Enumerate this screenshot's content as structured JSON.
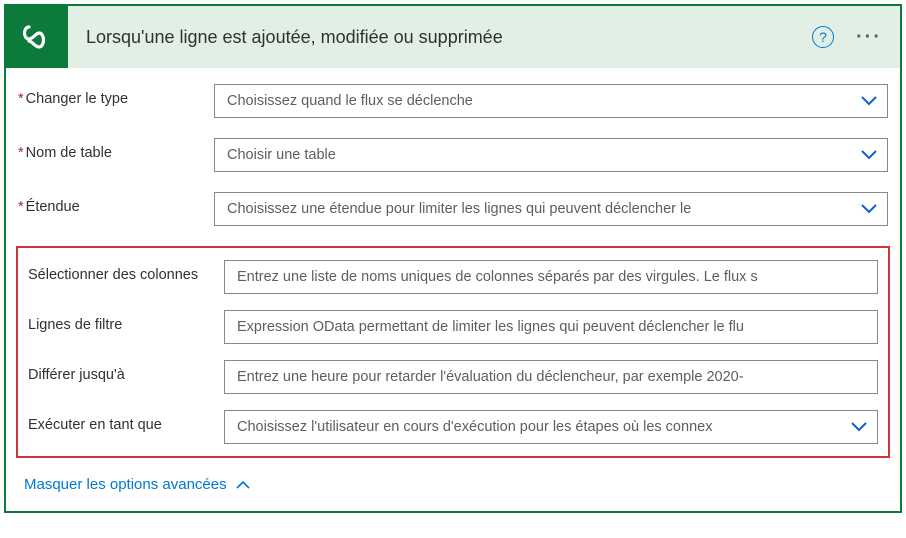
{
  "header": {
    "title": "Lorsqu'une ligne est ajoutée, modifiée ou supprimée"
  },
  "fields": {
    "change_type": {
      "label": "Changer le type",
      "placeholder": "Choisissez quand le flux se déclenche"
    },
    "table_name": {
      "label": "Nom de table",
      "placeholder": "Choisir une table"
    },
    "scope": {
      "label": "Étendue",
      "placeholder": "Choisissez une étendue pour limiter les lignes qui peuvent déclencher le"
    },
    "select_columns": {
      "label": "Sélectionner des colonnes",
      "placeholder": "Entrez une liste de noms uniques de colonnes séparés par des virgules. Le flux s"
    },
    "filter_rows": {
      "label": "Lignes de filtre",
      "placeholder": "Expression OData permettant de limiter les lignes qui peuvent déclencher le flu"
    },
    "delay_until": {
      "label": "Différer jusqu'à",
      "placeholder": "Entrez une heure pour retarder l'évaluation du déclencheur, par exemple 2020-"
    },
    "run_as": {
      "label": "Exécuter en tant que",
      "placeholder": "Choisissez l'utilisateur en cours d'exécution pour les étapes où les connex"
    }
  },
  "footer": {
    "toggle": "Masquer les options avancées"
  }
}
